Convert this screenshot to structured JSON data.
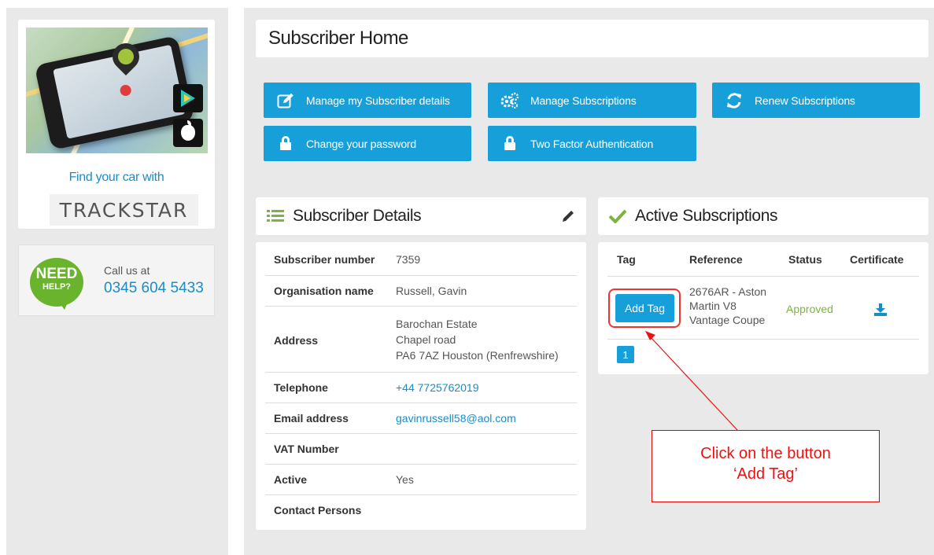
{
  "sidebar": {
    "promo_text": "Find your car with",
    "brand": "TRACKSTAR",
    "help_badge_line1": "NEED",
    "help_badge_line2": "HELP?",
    "call_label": "Call us at",
    "call_number": "0345 604 5433"
  },
  "page": {
    "title": "Subscriber Home"
  },
  "actions": [
    {
      "label": "Manage my Subscriber details",
      "icon": "edit-icon"
    },
    {
      "label": "Manage Subscriptions",
      "icon": "gears-icon"
    },
    {
      "label": "Renew Subscriptions",
      "icon": "refresh-icon"
    },
    {
      "label": "Change your password",
      "icon": "lock-icon"
    },
    {
      "label": "Two Factor Authentication",
      "icon": "lock-icon"
    }
  ],
  "details": {
    "title": "Subscriber Details",
    "rows": [
      {
        "label": "Subscriber number",
        "value": "7359"
      },
      {
        "label": "Organisation name",
        "value": "Russell, Gavin"
      },
      {
        "label": "Address",
        "line1": "Barochan Estate",
        "line2": "Chapel road",
        "line3": "PA6 7AZ Houston (Renfrewshire)"
      },
      {
        "label": "Telephone",
        "value": "+44 7725762019"
      },
      {
        "label": "Email address",
        "value": "gavinrussell58@aol.com"
      },
      {
        "label": "VAT Number",
        "value": ""
      },
      {
        "label": "Active",
        "value": "Yes"
      },
      {
        "label": "Contact Persons",
        "value": ""
      }
    ]
  },
  "subscriptions": {
    "title": "Active Subscriptions",
    "columns": [
      "Tag",
      "Reference",
      "Status",
      "Certificate"
    ],
    "rows": [
      {
        "tag_button": "Add Tag",
        "ref1": "2676AR - Aston",
        "ref2": "Martin V8",
        "ref3": "Vantage Coupe",
        "status": "Approved"
      }
    ],
    "pagination": [
      "1"
    ]
  },
  "callout": {
    "line1": "Click on the button",
    "line2": "‘Add Tag’"
  },
  "colors": {
    "primary": "#179fd9",
    "link": "#1a8cc8",
    "approved": "#7cb342",
    "annotation": "#e11111",
    "help_green": "#6ab42d"
  }
}
